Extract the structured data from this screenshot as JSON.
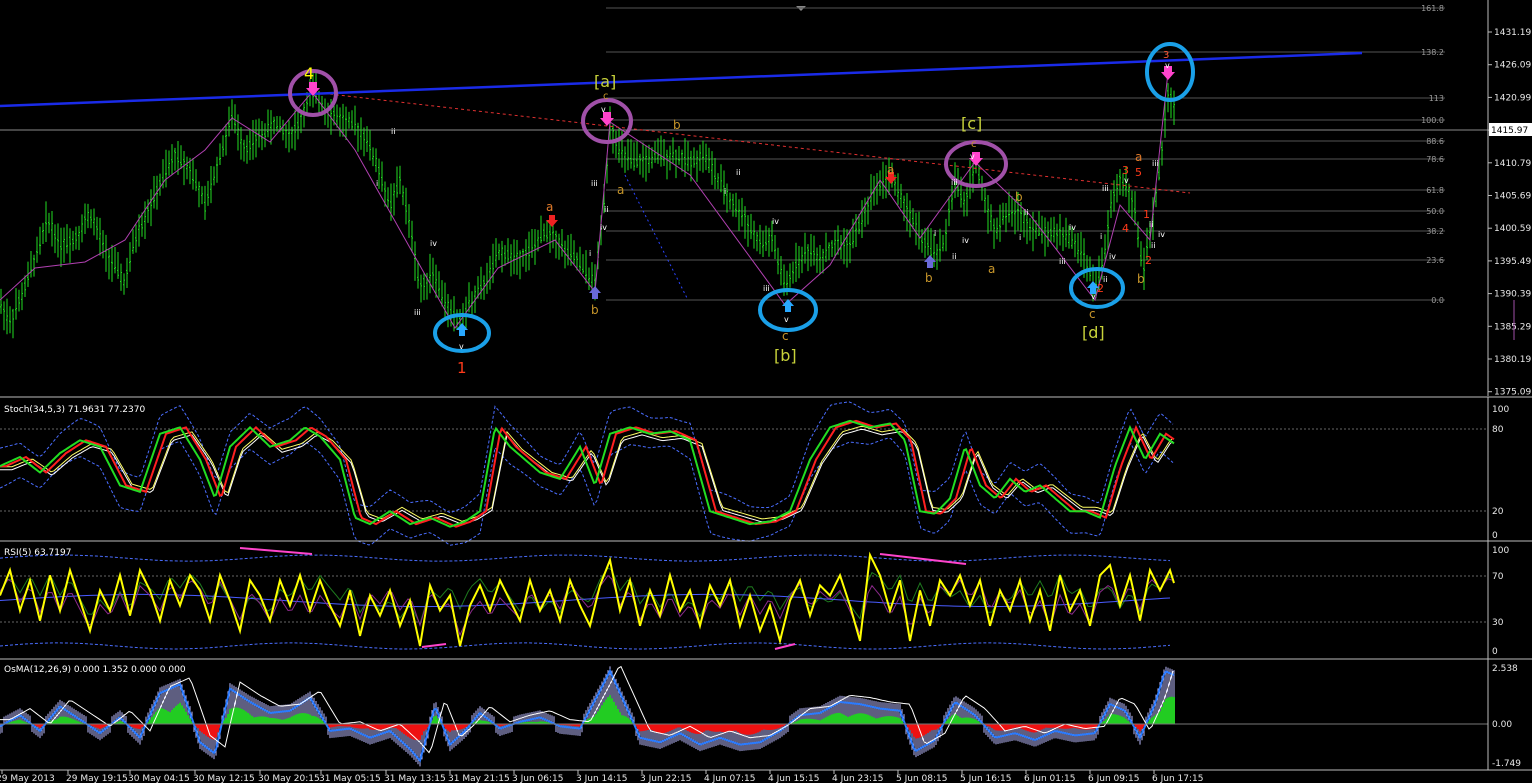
{
  "colors": {
    "background": "#000000",
    "candles": "#22dd22",
    "blue_trendline": "#1a2be8",
    "red_trendline": "#e03030",
    "circle_pink": "#a050a8",
    "circle_blue": "#1aa0e8",
    "zigzag": "#b040b0",
    "stoch_main": "#22dd22",
    "stoch_signal": "#ff2020",
    "rsi": "#ffff00",
    "osma_pos": "#22cc22",
    "osma_neg": "#ee1111",
    "osma_macd": "#2a7bff",
    "osma_signal": "#e8e8ff"
  },
  "price_axis": {
    "ticks": [
      "1431.19",
      "1426.09",
      "1420.99",
      "1415.97",
      "1410.79",
      "1405.69",
      "1400.59",
      "1395.49",
      "1390.39",
      "1385.29",
      "1380.19",
      "1375.09"
    ],
    "current_price": "1415.97"
  },
  "fib_levels": [
    "161.8",
    "138.2",
    "113",
    "100.0",
    "88.6",
    "78.6",
    "61.8",
    "50.0",
    "38.2",
    "23.6",
    "0.0"
  ],
  "time_axis": [
    "29 May 2013",
    "29 May 19:15",
    "30 May 04:15",
    "30 May 12:15",
    "30 May 20:15",
    "31 May 05:15",
    "31 May 13:15",
    "31 May 21:15",
    "3 Jun 06:15",
    "3 Jun 14:15",
    "3 Jun 22:15",
    "4 Jun 07:15",
    "4 Jun 15:15",
    "4 Jun 23:15",
    "5 Jun 08:15",
    "5 Jun 16:15",
    "6 Jun 01:15",
    "6 Jun 09:15",
    "6 Jun 17:15"
  ],
  "wave_labels": {
    "w4": "4",
    "w1": "1",
    "wa_bracket": "[a]",
    "wb_bracket": "[b]",
    "wc_bracket": "[c]",
    "wd_bracket": "[d]",
    "w3_top": "3",
    "w5": "5",
    "w3_small": "3",
    "w2": "2",
    "w4_small": "4",
    "w1_small": "1",
    "a": "a",
    "b": "b",
    "c": "c",
    "v": "v",
    "i": "i",
    "ii": "ii",
    "iii": "iii",
    "iv": "iv"
  },
  "indicators": {
    "stoch": {
      "title": "Stoch(34,5,3) 71.9631 77.2370",
      "levels": [
        "100",
        "80",
        "20",
        "0"
      ]
    },
    "rsi": {
      "title": "RSI(5) 63.7197",
      "levels": [
        "100",
        "70",
        "30",
        "0"
      ]
    },
    "osma": {
      "title": "OsMA(12,26,9) 0.000 1.352 0.000 0.000",
      "levels": [
        "2.538",
        "0.00",
        "-1.749"
      ]
    }
  },
  "chart_data": {
    "type": "candlestick",
    "instrument": "",
    "ylim": [
      1375.09,
      1436.0
    ],
    "close_path": [
      [
        0,
        1389
      ],
      [
        10,
        1386
      ],
      [
        22,
        1390
      ],
      [
        35,
        1396
      ],
      [
        48,
        1402
      ],
      [
        60,
        1398
      ],
      [
        75,
        1399
      ],
      [
        90,
        1403
      ],
      [
        105,
        1397
      ],
      [
        125,
        1392
      ],
      [
        135,
        1399
      ],
      [
        150,
        1404
      ],
      [
        165,
        1409
      ],
      [
        175,
        1412
      ],
      [
        190,
        1410
      ],
      [
        205,
        1404
      ],
      [
        220,
        1412
      ],
      [
        232,
        1418
      ],
      [
        245,
        1413
      ],
      [
        260,
        1415
      ],
      [
        275,
        1417
      ],
      [
        290,
        1415
      ],
      [
        300,
        1417
      ],
      [
        312,
        1422
      ],
      [
        322,
        1420
      ],
      [
        335,
        1418
      ],
      [
        350,
        1417
      ],
      [
        365,
        1415
      ],
      [
        378,
        1410
      ],
      [
        390,
        1404
      ],
      [
        400,
        1408
      ],
      [
        410,
        1401
      ],
      [
        420,
        1391
      ],
      [
        432,
        1394
      ],
      [
        445,
        1389
      ],
      [
        458,
        1386
      ],
      [
        470,
        1389
      ],
      [
        485,
        1392
      ],
      [
        500,
        1397
      ],
      [
        515,
        1396
      ],
      [
        530,
        1397
      ],
      [
        545,
        1400
      ],
      [
        556,
        1399
      ],
      [
        565,
        1397
      ],
      [
        575,
        1396
      ],
      [
        585,
        1394
      ],
      [
        595,
        1392
      ],
      [
        603,
        1403
      ],
      [
        610,
        1417
      ],
      [
        618,
        1413
      ],
      [
        630,
        1411
      ],
      [
        645,
        1411
      ],
      [
        660,
        1412
      ],
      [
        675,
        1412
      ],
      [
        690,
        1411
      ],
      [
        705,
        1412
      ],
      [
        718,
        1408
      ],
      [
        730,
        1405
      ],
      [
        745,
        1402
      ],
      [
        760,
        1398
      ],
      [
        772,
        1399
      ],
      [
        785,
        1391
      ],
      [
        795,
        1395
      ],
      [
        808,
        1397
      ],
      [
        820,
        1396
      ],
      [
        835,
        1398
      ],
      [
        850,
        1398
      ],
      [
        862,
        1402
      ],
      [
        875,
        1407
      ],
      [
        890,
        1409
      ],
      [
        905,
        1404
      ],
      [
        918,
        1400
      ],
      [
        930,
        1397
      ],
      [
        942,
        1397
      ],
      [
        955,
        1408
      ],
      [
        965,
        1404
      ],
      [
        975,
        1411
      ],
      [
        985,
        1405
      ],
      [
        995,
        1400
      ],
      [
        1005,
        1403
      ],
      [
        1018,
        1403
      ],
      [
        1030,
        1401
      ],
      [
        1042,
        1400
      ],
      [
        1055,
        1400
      ],
      [
        1070,
        1399
      ],
      [
        1085,
        1396
      ],
      [
        1095,
        1391
      ],
      [
        1105,
        1397
      ],
      [
        1112,
        1405
      ],
      [
        1120,
        1408
      ],
      [
        1128,
        1407
      ],
      [
        1135,
        1403
      ],
      [
        1143,
        1394
      ],
      [
        1152,
        1401
      ],
      [
        1160,
        1410
      ],
      [
        1168,
        1422
      ],
      [
        1175,
        1419
      ]
    ],
    "stoch": [
      [
        0,
        55
      ],
      [
        20,
        62
      ],
      [
        40,
        50
      ],
      [
        60,
        65
      ],
      [
        80,
        75
      ],
      [
        100,
        70
      ],
      [
        120,
        40
      ],
      [
        140,
        35
      ],
      [
        160,
        80
      ],
      [
        180,
        85
      ],
      [
        200,
        60
      ],
      [
        215,
        30
      ],
      [
        230,
        70
      ],
      [
        250,
        85
      ],
      [
        270,
        70
      ],
      [
        290,
        75
      ],
      [
        305,
        85
      ],
      [
        320,
        78
      ],
      [
        340,
        60
      ],
      [
        355,
        15
      ],
      [
        370,
        10
      ],
      [
        390,
        20
      ],
      [
        410,
        10
      ],
      [
        430,
        15
      ],
      [
        450,
        8
      ],
      [
        465,
        12
      ],
      [
        480,
        20
      ],
      [
        495,
        85
      ],
      [
        510,
        70
      ],
      [
        525,
        60
      ],
      [
        540,
        50
      ],
      [
        560,
        45
      ],
      [
        580,
        70
      ],
      [
        595,
        40
      ],
      [
        610,
        80
      ],
      [
        630,
        85
      ],
      [
        650,
        80
      ],
      [
        670,
        82
      ],
      [
        690,
        75
      ],
      [
        710,
        20
      ],
      [
        730,
        15
      ],
      [
        750,
        10
      ],
      [
        770,
        12
      ],
      [
        790,
        20
      ],
      [
        810,
        60
      ],
      [
        830,
        85
      ],
      [
        850,
        90
      ],
      [
        870,
        85
      ],
      [
        890,
        88
      ],
      [
        905,
        75
      ],
      [
        920,
        20
      ],
      [
        935,
        18
      ],
      [
        950,
        30
      ],
      [
        965,
        70
      ],
      [
        980,
        40
      ],
      [
        995,
        30
      ],
      [
        1010,
        45
      ],
      [
        1025,
        35
      ],
      [
        1040,
        40
      ],
      [
        1055,
        30
      ],
      [
        1070,
        20
      ],
      [
        1085,
        20
      ],
      [
        1100,
        15
      ],
      [
        1115,
        55
      ],
      [
        1130,
        85
      ],
      [
        1145,
        60
      ],
      [
        1160,
        80
      ],
      [
        1175,
        72
      ]
    ],
    "rsi": [
      [
        0,
        55
      ],
      [
        10,
        80
      ],
      [
        20,
        40
      ],
      [
        30,
        70
      ],
      [
        40,
        30
      ],
      [
        50,
        75
      ],
      [
        60,
        40
      ],
      [
        70,
        80
      ],
      [
        80,
        50
      ],
      [
        90,
        20
      ],
      [
        100,
        60
      ],
      [
        110,
        40
      ],
      [
        120,
        75
      ],
      [
        130,
        35
      ],
      [
        140,
        80
      ],
      [
        150,
        60
      ],
      [
        160,
        30
      ],
      [
        170,
        70
      ],
      [
        180,
        45
      ],
      [
        190,
        75
      ],
      [
        200,
        60
      ],
      [
        210,
        30
      ],
      [
        220,
        75
      ],
      [
        230,
        50
      ],
      [
        240,
        20
      ],
      [
        250,
        70
      ],
      [
        260,
        55
      ],
      [
        270,
        30
      ],
      [
        280,
        70
      ],
      [
        290,
        45
      ],
      [
        300,
        75
      ],
      [
        310,
        40
      ],
      [
        320,
        70
      ],
      [
        330,
        45
      ],
      [
        340,
        25
      ],
      [
        350,
        60
      ],
      [
        360,
        15
      ],
      [
        370,
        55
      ],
      [
        380,
        35
      ],
      [
        390,
        60
      ],
      [
        400,
        25
      ],
      [
        410,
        50
      ],
      [
        420,
        5
      ],
      [
        430,
        65
      ],
      [
        440,
        40
      ],
      [
        450,
        55
      ],
      [
        460,
        5
      ],
      [
        470,
        45
      ],
      [
        480,
        65
      ],
      [
        490,
        40
      ],
      [
        500,
        70
      ],
      [
        510,
        50
      ],
      [
        520,
        30
      ],
      [
        530,
        70
      ],
      [
        540,
        40
      ],
      [
        550,
        60
      ],
      [
        560,
        30
      ],
      [
        570,
        70
      ],
      [
        580,
        45
      ],
      [
        590,
        25
      ],
      [
        600,
        65
      ],
      [
        610,
        90
      ],
      [
        620,
        40
      ],
      [
        630,
        70
      ],
      [
        640,
        25
      ],
      [
        650,
        60
      ],
      [
        660,
        35
      ],
      [
        670,
        75
      ],
      [
        680,
        40
      ],
      [
        690,
        60
      ],
      [
        700,
        25
      ],
      [
        710,
        65
      ],
      [
        720,
        45
      ],
      [
        730,
        70
      ],
      [
        740,
        25
      ],
      [
        750,
        55
      ],
      [
        760,
        20
      ],
      [
        770,
        45
      ],
      [
        780,
        10
      ],
      [
        790,
        50
      ],
      [
        800,
        70
      ],
      [
        810,
        35
      ],
      [
        820,
        65
      ],
      [
        830,
        55
      ],
      [
        840,
        75
      ],
      [
        850,
        45
      ],
      [
        860,
        10
      ],
      [
        870,
        95
      ],
      [
        880,
        75
      ],
      [
        890,
        40
      ],
      [
        900,
        70
      ],
      [
        910,
        10
      ],
      [
        920,
        60
      ],
      [
        930,
        25
      ],
      [
        940,
        70
      ],
      [
        950,
        55
      ],
      [
        960,
        75
      ],
      [
        970,
        45
      ],
      [
        980,
        70
      ],
      [
        990,
        25
      ],
      [
        1000,
        60
      ],
      [
        1010,
        40
      ],
      [
        1020,
        70
      ],
      [
        1030,
        30
      ],
      [
        1040,
        60
      ],
      [
        1050,
        20
      ],
      [
        1060,
        75
      ],
      [
        1070,
        40
      ],
      [
        1080,
        60
      ],
      [
        1090,
        25
      ],
      [
        1100,
        75
      ],
      [
        1110,
        85
      ],
      [
        1120,
        45
      ],
      [
        1130,
        75
      ],
      [
        1140,
        30
      ],
      [
        1150,
        80
      ],
      [
        1160,
        60
      ],
      [
        1170,
        80
      ],
      [
        1175,
        64
      ]
    ],
    "osma": [
      [
        0,
        -0.1
      ],
      [
        20,
        0.4
      ],
      [
        40,
        -0.3
      ],
      [
        60,
        0.8
      ],
      [
        80,
        0.2
      ],
      [
        100,
        -0.4
      ],
      [
        120,
        0.3
      ],
      [
        140,
        -0.6
      ],
      [
        160,
        1.4
      ],
      [
        180,
        1.8
      ],
      [
        200,
        -0.8
      ],
      [
        215,
        -1.3
      ],
      [
        230,
        1.6
      ],
      [
        250,
        1.0
      ],
      [
        270,
        0.5
      ],
      [
        290,
        0.6
      ],
      [
        310,
        1.2
      ],
      [
        330,
        -0.3
      ],
      [
        350,
        -0.2
      ],
      [
        370,
        -0.6
      ],
      [
        390,
        -0.3
      ],
      [
        410,
        -1.1
      ],
      [
        420,
        -1.6
      ],
      [
        435,
        0.8
      ],
      [
        450,
        -0.9
      ],
      [
        465,
        -0.3
      ],
      [
        480,
        0.5
      ],
      [
        500,
        -0.2
      ],
      [
        520,
        0.1
      ],
      [
        540,
        0.3
      ],
      [
        560,
        -0.1
      ],
      [
        580,
        -0.2
      ],
      [
        600,
        1.5
      ],
      [
        610,
        2.4
      ],
      [
        625,
        0.9
      ],
      [
        640,
        -0.6
      ],
      [
        660,
        -0.8
      ],
      [
        680,
        -0.4
      ],
      [
        700,
        -0.9
      ],
      [
        720,
        -0.6
      ],
      [
        740,
        -0.9
      ],
      [
        760,
        -0.8
      ],
      [
        780,
        -0.3
      ],
      [
        800,
        0.4
      ],
      [
        820,
        0.5
      ],
      [
        840,
        1.0
      ],
      [
        860,
        0.9
      ],
      [
        880,
        0.7
      ],
      [
        900,
        0.6
      ],
      [
        915,
        -1.2
      ],
      [
        935,
        -0.7
      ],
      [
        955,
        1.0
      ],
      [
        975,
        0.4
      ],
      [
        995,
        -0.6
      ],
      [
        1015,
        -0.4
      ],
      [
        1035,
        -0.7
      ],
      [
        1055,
        -0.3
      ],
      [
        1075,
        -0.5
      ],
      [
        1095,
        -0.4
      ],
      [
        1110,
        0.9
      ],
      [
        1125,
        0.6
      ],
      [
        1140,
        -0.6
      ],
      [
        1155,
        0.9
      ],
      [
        1165,
        2.4
      ],
      [
        1175,
        2.2
      ]
    ]
  }
}
